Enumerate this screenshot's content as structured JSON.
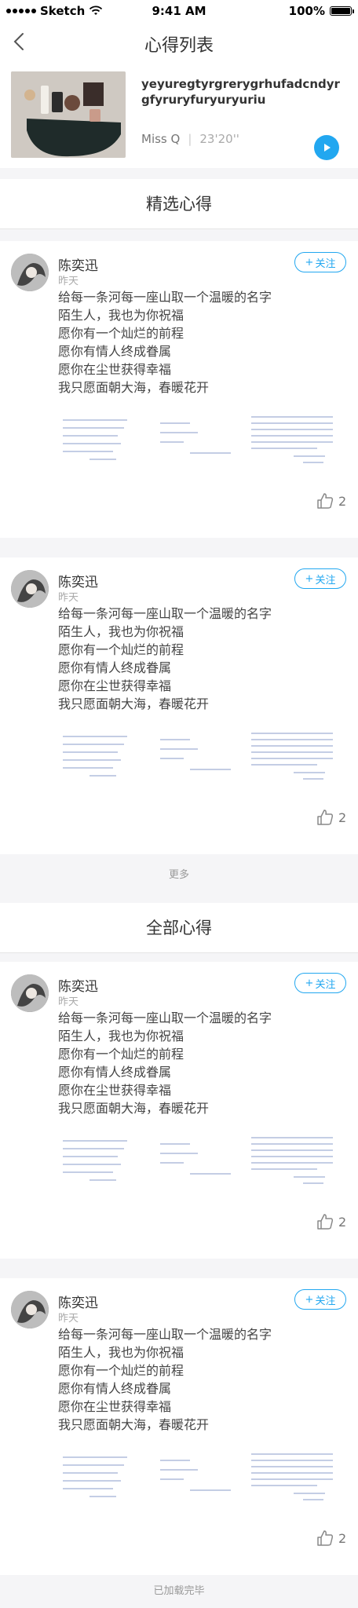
{
  "status": {
    "carrier": "Sketch",
    "time": "9:41 AM",
    "battery": "100%"
  },
  "nav": {
    "title": "心得列表",
    "back_icon": "chevron-left-icon"
  },
  "header": {
    "title": "yeyuregtyrgrerygrhufadcndyrgfyruryfuryuryuriu",
    "author": "Miss Q",
    "duration": "23'20''",
    "play_icon": "play-icon"
  },
  "sections": {
    "featured": "精选心得",
    "all": "全部心得"
  },
  "more_label": "更多",
  "end_label": "已加载完毕",
  "posts": [
    {
      "name": "陈奕迅",
      "date": "昨天",
      "follow": "关注",
      "likes": "2",
      "lines": [
        "给每一条河每一座山取一个温暖的名字",
        "陌生人，我也为你祝福",
        "愿你有一个灿烂的前程",
        "愿你有情人终成眷属",
        "愿你在尘世获得幸福",
        "我只愿面朝大海，春暖花开"
      ]
    },
    {
      "name": "陈奕迅",
      "date": "昨天",
      "follow": "关注",
      "likes": "2",
      "lines": [
        "给每一条河每一座山取一个温暖的名字",
        "陌生人，我也为你祝福",
        "愿你有一个灿烂的前程",
        "愿你有情人终成眷属",
        "愿你在尘世获得幸福",
        "我只愿面朝大海，春暖花开"
      ]
    },
    {
      "name": "陈奕迅",
      "date": "昨天",
      "follow": "关注",
      "likes": "2",
      "lines": [
        "给每一条河每一座山取一个温暖的名字",
        "陌生人，我也为你祝福",
        "愿你有一个灿烂的前程",
        "愿你有情人终成眷属",
        "愿你在尘世获得幸福",
        "我只愿面朝大海，春暖花开"
      ]
    },
    {
      "name": "陈奕迅",
      "date": "昨天",
      "follow": "关注",
      "likes": "2",
      "lines": [
        "给每一条河每一座山取一个温暖的名字",
        "陌生人，我也为你祝福",
        "愿你有一个灿烂的前程",
        "愿你有情人终成眷属",
        "愿你在尘世获得幸福",
        "我只愿面朝大海，春暖花开"
      ]
    }
  ],
  "colors": {
    "accent": "#22a7f0",
    "background": "#f5f5f7"
  }
}
